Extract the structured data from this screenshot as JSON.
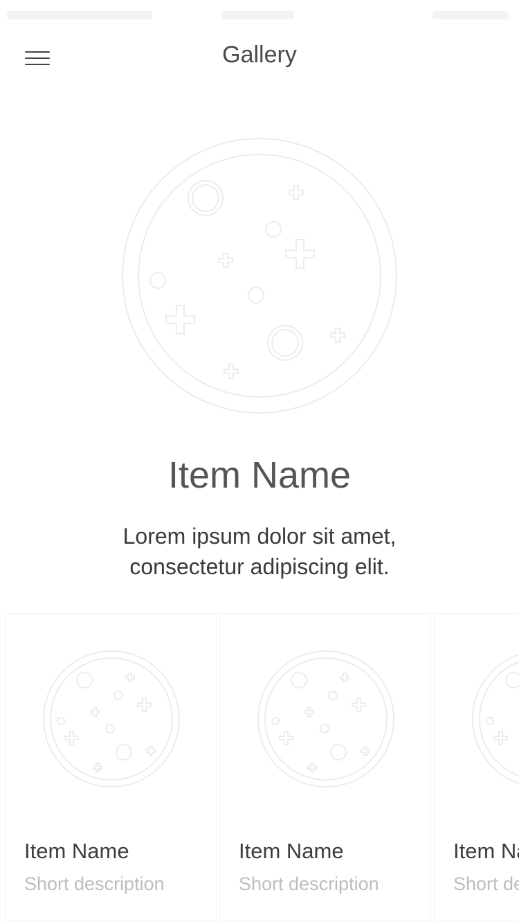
{
  "header": {
    "title": "Gallery",
    "menu_icon": "hamburger-menu-icon"
  },
  "hero": {
    "image_icon": "planet-placeholder-icon",
    "item_name": "Item Name",
    "description_line1": "Lorem ipsum dolor sit amet,",
    "description_line2": "consectetur  adipiscing elit."
  },
  "cards": [
    {
      "title": "Item Name",
      "description": "Short description",
      "image_icon": "planet-placeholder-icon"
    },
    {
      "title": "Item Name",
      "description": "Short description",
      "image_icon": "planet-placeholder-icon"
    },
    {
      "title": "Item Name",
      "description": "Short description",
      "image_icon": "planet-placeholder-icon"
    }
  ],
  "colors": {
    "title_text": "#4a4a4a",
    "secondary_text": "#bdbdbd",
    "placeholder_stroke": "#ececec"
  }
}
